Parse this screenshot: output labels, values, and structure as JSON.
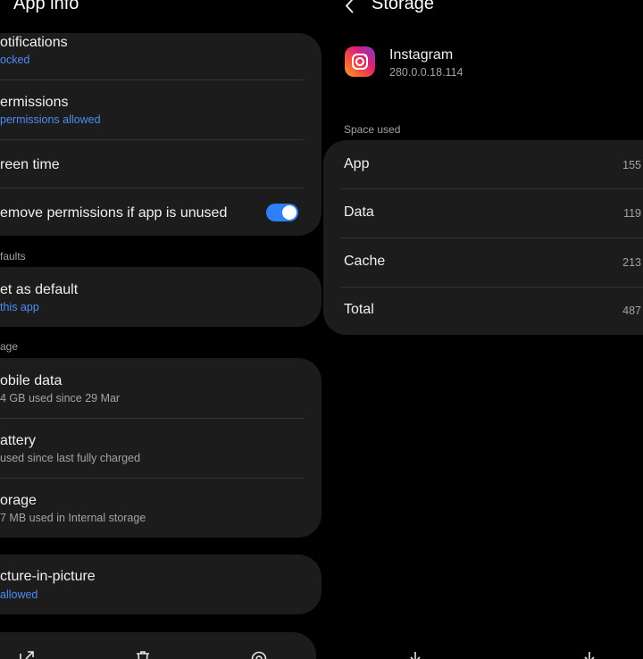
{
  "left_panel": {
    "title": "App info",
    "card1": {
      "notifications": {
        "title": "otifications",
        "sub": "ocked"
      },
      "permissions": {
        "title": "ermissions",
        "sub": "permissions allowed"
      },
      "screen_time": {
        "title": "reen time"
      },
      "remove_permissions": {
        "title": "emove permissions if app is unused",
        "toggle_on": true
      }
    },
    "defaults_section": "faults",
    "card2": {
      "set_default": {
        "title": "et as default",
        "sub": "this app"
      }
    },
    "usage_section": "age",
    "card3": {
      "mobile_data": {
        "title": "obile data",
        "sub": "4 GB used since 29 Mar"
      },
      "battery": {
        "title": "attery",
        "sub": "used since last fully charged"
      },
      "storage": {
        "title": "orage",
        "sub": "7 MB used in Internal storage"
      }
    },
    "card4": {
      "pip": {
        "title": "cture-in-picture",
        "sub": "allowed"
      }
    }
  },
  "right_panel": {
    "title": "Storage",
    "app": {
      "name": "Instagram",
      "version": "280.0.0.18.114"
    },
    "space_used_section": "Space used",
    "rows": [
      {
        "label": "App",
        "value": "155"
      },
      {
        "label": "Data",
        "value": "119"
      },
      {
        "label": "Cache",
        "value": "213"
      },
      {
        "label": "Total",
        "value": "487"
      }
    ]
  },
  "colors": {
    "background": "#000000",
    "card": "#1c1c1c",
    "accent": "#2f7ff6",
    "link_blue": "#4e8cf5",
    "secondary_text": "#a3a3a3"
  },
  "icons": [
    "back-icon",
    "open-icon",
    "uninstall-icon",
    "force-stop-icon",
    "storage-action-icon"
  ]
}
